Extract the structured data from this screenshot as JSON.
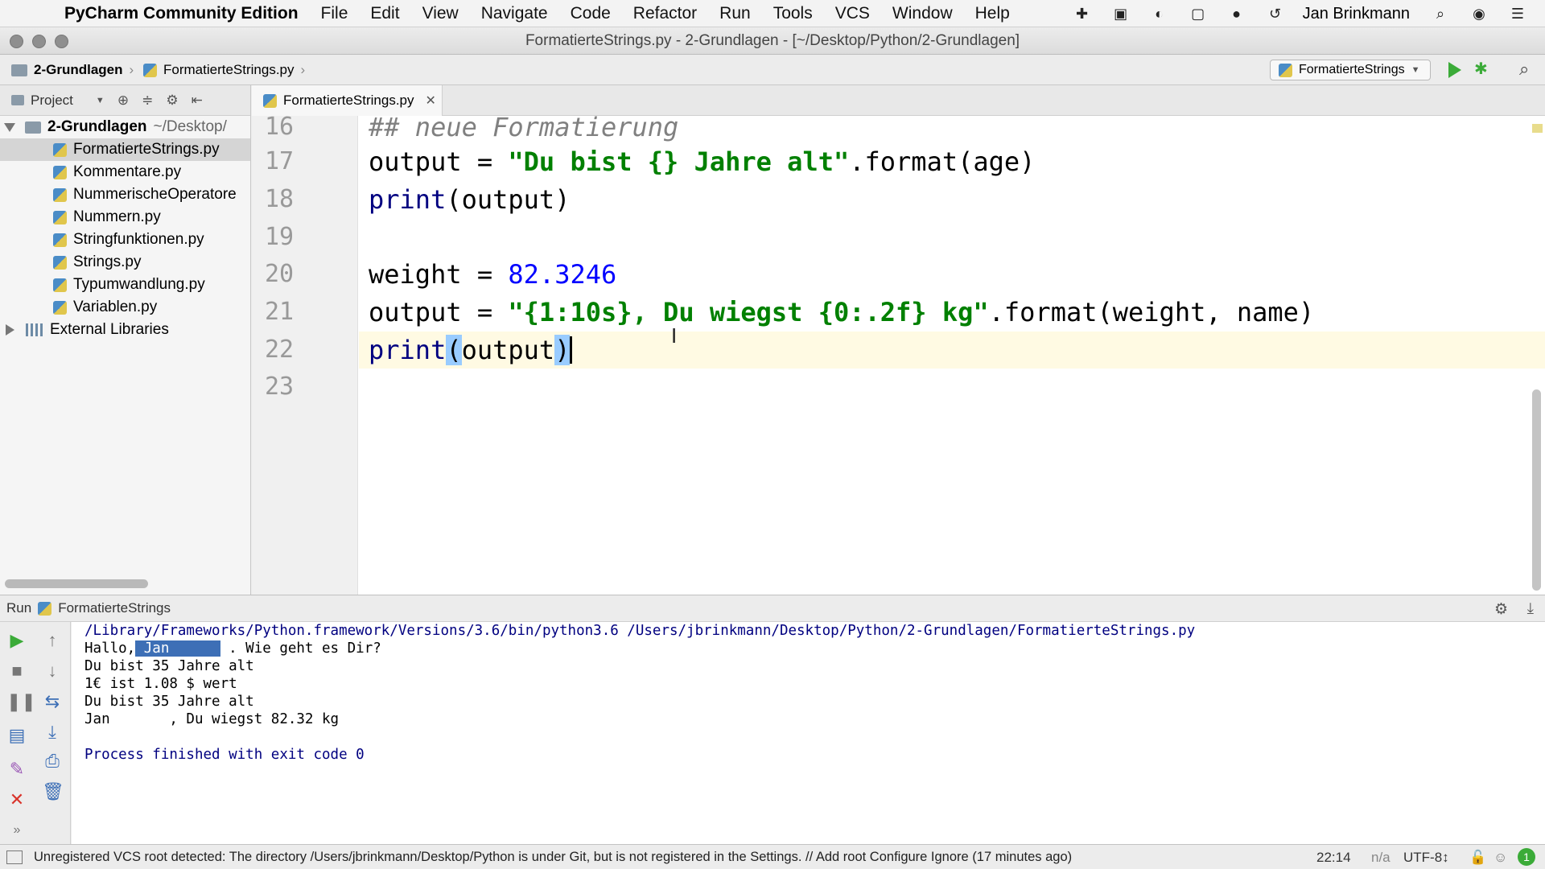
{
  "menubar": {
    "app_name": "PyCharm Community Edition",
    "items": [
      "File",
      "Edit",
      "View",
      "Navigate",
      "Code",
      "Refactor",
      "Run",
      "Tools",
      "VCS",
      "Window",
      "Help"
    ],
    "user": "Jan Brinkmann"
  },
  "window": {
    "title": "FormatierteStrings.py - 2-Grundlagen - [~/Desktop/Python/2-Grundlagen]"
  },
  "navbar": {
    "crumb_project": "2-Grundlagen",
    "crumb_file": "FormatierteStrings.py",
    "run_config": "FormatierteStrings"
  },
  "sidebar": {
    "title": "Project",
    "root": {
      "name": "2-Grundlagen",
      "path": "~/Desktop/"
    },
    "files": [
      "FormatierteStrings.py",
      "Kommentare.py",
      "NummerischeOperatore",
      "Nummern.py",
      "Stringfunktionen.py",
      "Strings.py",
      "Typumwandlung.py",
      "Variablen.py"
    ],
    "external": "External Libraries"
  },
  "editor": {
    "tab": "FormatierteStrings.py",
    "line_numbers": [
      "16",
      "17",
      "18",
      "19",
      "20",
      "21",
      "22",
      "23"
    ],
    "lines": {
      "l16": "## neue Formatierung",
      "l17_a": "output = ",
      "l17_str": "\"Du bist {} Jahre alt\"",
      "l17_b": ".format(age)",
      "l18_kw": "print",
      "l18_b": "(output)",
      "l20_a": "weight = ",
      "l20_num": "82.3246",
      "l21_a": "output = ",
      "l21_str": "\"{1:10s}, Du wiegst {0:.2f} kg\"",
      "l21_b": ".format(weight, name)",
      "l22_kw": "print",
      "l22_open": "(",
      "l22_mid": "output",
      "l22_close": ")"
    }
  },
  "run_panel": {
    "label": "Run",
    "config": "FormatierteStrings",
    "output": {
      "path": "/Library/Frameworks/Python.framework/Versions/3.6/bin/python3.6 /Users/jbrinkmann/Desktop/Python/2-Grundlagen/FormatierteStrings.py",
      "line1_a": "Hallo,",
      "line1_sel": " Jan      ",
      "line1_b": " . Wie geht es Dir?",
      "line2": "Du bist 35 Jahre alt",
      "line3": "1€ ist 1.08 $ wert",
      "line4": "Du bist 35 Jahre alt",
      "line5": "Jan       , Du wiegst 82.32 kg",
      "finished": "Process finished with exit code 0"
    }
  },
  "statusbar": {
    "message": "Unregistered VCS root detected: The directory /Users/jbrinkmann/Desktop/Python is under Git, but is not registered in the Settings. // Add root  Configure  Ignore (17 minutes ago)",
    "position": "22:14",
    "na": "n/a",
    "encoding": "UTF-8↕"
  },
  "colors": {
    "keyword": "#000080",
    "string": "#008000",
    "number": "#0000ff",
    "comment": "#808080",
    "run_green": "#3bab38"
  },
  "icons": [
    "apple-icon",
    "search-icon",
    "gear-icon",
    "run-icon",
    "debug-icon",
    "close-icon",
    "folder-icon",
    "python-file-icon"
  ]
}
